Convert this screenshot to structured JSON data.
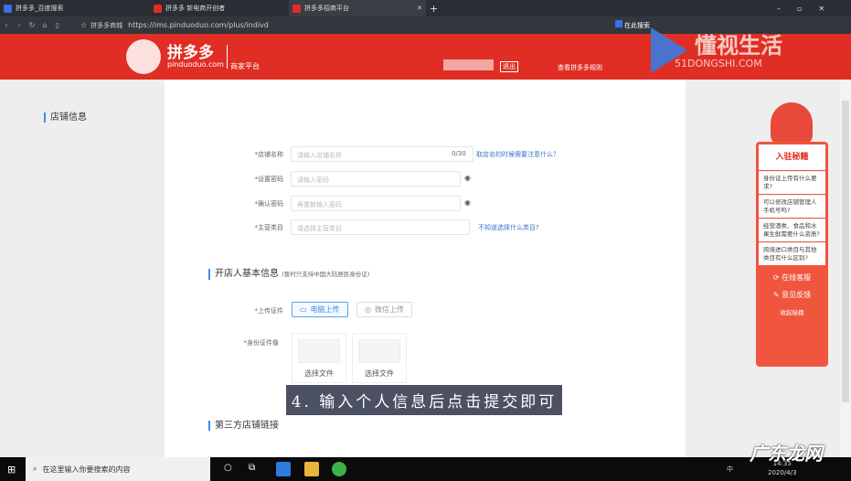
{
  "browser": {
    "tabs": [
      {
        "label": "拼多多_百度搜索"
      },
      {
        "label": "拼多多 新电商开创者"
      },
      {
        "label": "拼多多招商平台",
        "active": true
      }
    ],
    "url_site_label": "拼多多商城",
    "url": "https://ims.pinduoduo.com/plus/indivd",
    "search_label": "在此搜索"
  },
  "header": {
    "logo_text": "拼多多",
    "logo_domain": "pinduoduo.com",
    "platform": "商家平台",
    "logout": "退出",
    "rules_link": "查看拼多多规则"
  },
  "watermark": {
    "brand": "懂视生活",
    "domain": "51DONGSHI.COM",
    "corner": "广东龙网"
  },
  "form": {
    "section_shop": "店铺信息",
    "shop_name_label": "*店铺名称",
    "shop_name_placeholder": "请输入店铺名称",
    "shop_name_count": "0/30",
    "shop_name_help": "取店名的时候需要注意什么？",
    "password_label": "*设置密码",
    "password_placeholder": "请输入密码",
    "confirm_label": "*确认密码",
    "confirm_placeholder": "再重新输入密码",
    "category_label": "*主营类目",
    "category_placeholder": "请选择主营类目",
    "category_help": "不知道选择什么类目?",
    "section_owner": "开店人基本信息",
    "owner_note": "(暂时只支持中国大陆居民身份证)",
    "upload_label": "*上传证件",
    "upload_pc": "电脑上传",
    "upload_wechat": "微信上传",
    "id_label": "*身份证件像",
    "choose_file_1": "选择文件",
    "choose_file_2": "选择文件",
    "section_third": "第三方店铺链接"
  },
  "caption": "4. 输入个人信息后点击提交即可",
  "widget": {
    "title": "入驻秘籍",
    "questions": [
      "身份证上传有什么要求?",
      "可以修改店铺管理人手机号吗?",
      "经营酒类、食品和水果生鲜需要什么资质?",
      "跨境进口类目与其他类目有什么区别?"
    ],
    "online_service": "在线客服",
    "feedback": "意见反馈",
    "collapse": "收起秘籍"
  },
  "taskbar": {
    "search_placeholder": "在这里输入你要搜索的内容",
    "time": "14:35",
    "date": "2020/4/3",
    "ime": "中"
  }
}
